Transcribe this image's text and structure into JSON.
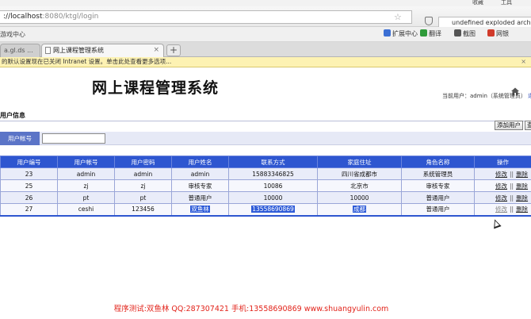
{
  "browser": {
    "top_right_1": "收藏",
    "top_right_2": "工具",
    "url_host": "://localhost",
    "url_rest": ":8080/ktgl/login",
    "search_text": "undefined exploded archi",
    "bookmarks_left": "游戏中心",
    "bookmarks": [
      {
        "label": "扩展中心",
        "icon": "puzzle-icon",
        "color": "#3b6fd4"
      },
      {
        "label": "翻译",
        "icon": "translate-icon",
        "color": "#2f9b3a"
      },
      {
        "label": "截图",
        "icon": "scissors-icon",
        "color": "#555555"
      },
      {
        "label": "网银",
        "icon": "bank-icon",
        "color": "#d13b2b"
      }
    ],
    "tabs": [
      {
        "label": "a.gl.ds ..."
      },
      {
        "label": "网上课程管理系统"
      }
    ],
    "infobar_text": "的默认设置现在已关闭 Intranet 设置。单击此处查看更多选项..."
  },
  "page": {
    "title": "网上课程管理系统",
    "current_user_prefix": "当前用户：",
    "current_user_name": "admin",
    "current_user_role": "（系统管理员）",
    "current_user_exit": "退",
    "section_title": "用户信息",
    "add_button": "添加用户",
    "search_button": "查",
    "search_label": "用户帐号",
    "search_value": ""
  },
  "table": {
    "columns": [
      "用户编号",
      "用户帐号",
      "用户密码",
      "用户姓名",
      "联系方式",
      "家庭住址",
      "角色名称",
      "操作"
    ],
    "rows": [
      [
        "23",
        "admin",
        "admin",
        "admin",
        "15883346825",
        "四川省成都市",
        "系统管理员"
      ],
      [
        "25",
        "zj",
        "zj",
        "审核专家",
        "10086",
        "北京市",
        "审核专家"
      ],
      [
        "26",
        "pt",
        "pt",
        "普通用户",
        "10000",
        "10000",
        "普通用户"
      ],
      [
        "27",
        "ceshi",
        "123456",
        "双鱼林",
        "13558690869",
        "成都",
        "普通用户"
      ]
    ],
    "op_edit": "修改",
    "op_sep": "||",
    "op_delete": "删除"
  },
  "footer": "程序测试:双鱼林 QQ:287307421 手机:13558690869 www.shuangyulin.com",
  "colors": {
    "header_blue": "#2e56d0",
    "label_blue": "#5b74c7",
    "footer_red": "#e2231a",
    "infobar_yellow": "#fdf2b3"
  }
}
